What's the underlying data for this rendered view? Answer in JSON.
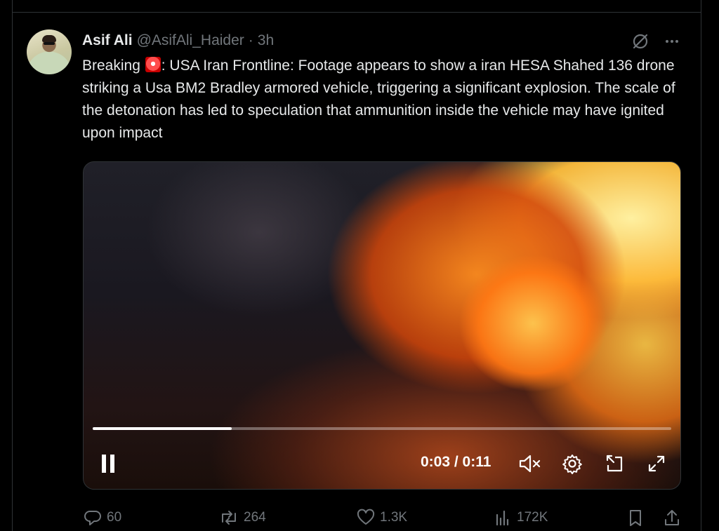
{
  "tweet": {
    "author_name": "Asif Ali",
    "handle": "@AsifAli_Haider",
    "separator": "·",
    "time": "3h",
    "text_prefix": "Breaking",
    "text_emoji_icon": "police-car-light-emoji",
    "text_body": ": USA Iran Frontline: Footage appears to show a iran HESA Shahed 136 drone striking a Usa BM2 Bradley armored vehicle, triggering a significant explosion. The scale of the detonation has led to speculation that ammunition inside the vehicle may have ignited upon impact"
  },
  "video": {
    "current_time": "0:03",
    "duration": "0:11",
    "time_display": "0:03 / 0:11",
    "progress_fraction": 0.24,
    "state": "playing"
  },
  "actions": {
    "replies": "60",
    "reposts": "264",
    "likes": "1.3K",
    "views": "172K"
  },
  "icons": {
    "header": [
      "grok-icon",
      "more-icon"
    ],
    "controls": [
      "pause-icon",
      "mute-icon",
      "settings-icon",
      "picture-in-picture-icon",
      "fullscreen-icon"
    ],
    "actions": [
      "reply-icon",
      "repost-icon",
      "like-icon",
      "views-icon",
      "bookmark-icon",
      "share-icon"
    ]
  },
  "colors": {
    "background": "#000000",
    "text_primary": "#e7e9ea",
    "text_secondary": "#71767b",
    "border": "#2f3336"
  }
}
